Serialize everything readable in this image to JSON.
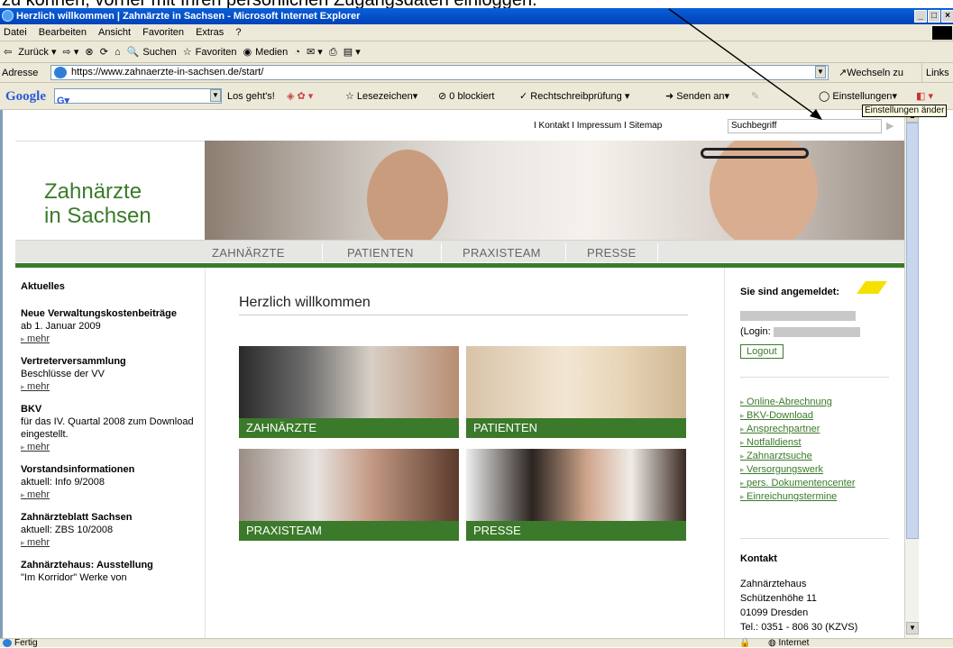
{
  "caption": "zu können, vorher mit Ihren persönlichen Zugangsdaten einloggen.",
  "window": {
    "title": "Herzlich willkommen | Zahnärzte in Sachsen - Microsoft Internet Explorer"
  },
  "menubar": [
    "Datei",
    "Bearbeiten",
    "Ansicht",
    "Favoriten",
    "Extras",
    "?"
  ],
  "toolbar": {
    "back": "Zurück",
    "search": "Suchen",
    "favorites": "Favoriten",
    "media": "Medien"
  },
  "address": {
    "label": "Adresse",
    "url": "https://www.zahnaerzte-in-sachsen.de/start/",
    "go": "Wechseln zu",
    "links": "Links"
  },
  "googlebar": {
    "logo": "Google",
    "go": "Los geht's!",
    "bookmarks": "Lesezeichen",
    "blocked": "0 blockiert",
    "spell": "Rechtschreibprüfung",
    "send": "Senden an",
    "settings": "Einstellungen",
    "tooltip": "Einstellungen änder"
  },
  "site": {
    "topnav": "I Kontakt I Impressum I Sitemap",
    "search_placeholder": "Suchbegriff",
    "logo_line1": "Zahnärzte",
    "logo_line2": "in Sachsen",
    "nav": [
      "ZAHNÄRZTE",
      "PATIENTEN",
      "PRAXISTEAM",
      "PRESSE"
    ],
    "left": {
      "heading": "Aktuelles",
      "items": [
        {
          "title": "Neue Verwaltungskostenbeiträge",
          "text": "ab 1. Januar 2009",
          "more": "mehr"
        },
        {
          "title": "Vertreterversammlung",
          "text": "Beschlüsse der VV",
          "more": "mehr"
        },
        {
          "title": "BKV",
          "text": "für das IV. Quartal 2008 zum Download eingestellt.",
          "more": "mehr"
        },
        {
          "title": "Vorstandsinformationen",
          "text": "aktuell: Info 9/2008",
          "more": "mehr"
        },
        {
          "title": "Zahnärzteblatt Sachsen",
          "text": "aktuell: ZBS 10/2008",
          "more": "mehr"
        },
        {
          "title": "Zahnärztehaus: Ausstellung",
          "text": "\"Im Korridor\" Werke von",
          "more": ""
        }
      ]
    },
    "welcome": "Herzlich willkommen",
    "tiles": [
      "ZAHNÄRZTE",
      "PATIENTEN",
      "PRAXISTEAM",
      "PRESSE"
    ],
    "right": {
      "logged_in": "Sie sind angemeldet:",
      "login_label": "(Login:",
      "logout": "Logout",
      "links": [
        "Online-Abrechnung",
        "BKV-Download",
        "Ansprechpartner",
        "Notfalldienst",
        "Zahnarztsuche",
        "Versorgungswerk",
        "pers. Dokumentencenter",
        "Einreichungstermine"
      ],
      "contact_heading": "Kontakt",
      "contact_lines": [
        "Zahnärztehaus",
        "Schützenhöhe 11",
        "01099 Dresden",
        "Tel.: 0351 - 806 30 (KZVS)"
      ]
    }
  },
  "status": {
    "left": "Fertig",
    "zone": "Internet"
  },
  "colors": {
    "brand_green": "#3b7a2a",
    "xp_blue": "#0a5fd8"
  }
}
